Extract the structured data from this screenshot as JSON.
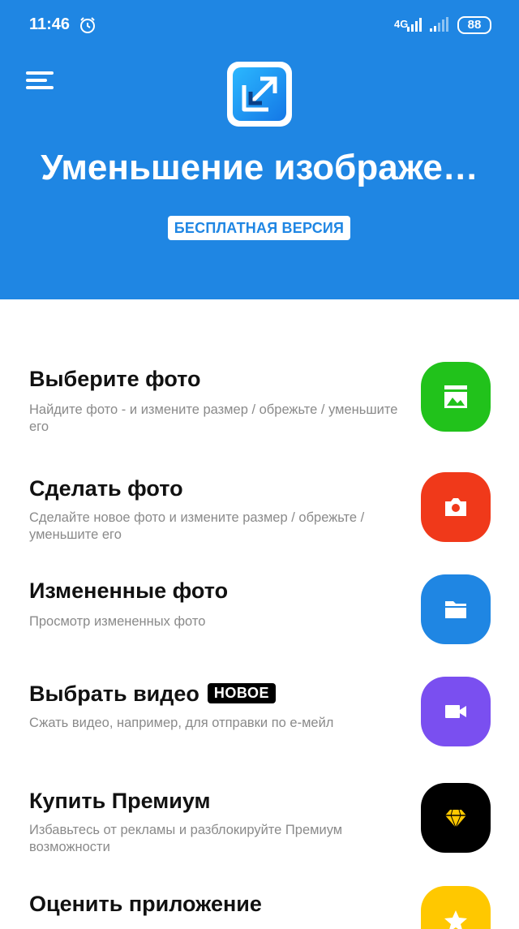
{
  "status_bar": {
    "time": "11:46",
    "network": "4G",
    "battery": "88"
  },
  "header": {
    "title": "Уменьшение изображе…",
    "version_badge": "БЕСПЛАТНАЯ ВЕРСИЯ"
  },
  "menu": [
    {
      "title": "Выберите фото",
      "description": "Найдите фото - и измените размер / обрежьте / уменьшите его",
      "icon": "gallery-icon",
      "color": "#21c21b"
    },
    {
      "title": "Сделать фото",
      "description": "Сделайте новое фото и измените размер / обрежьте / уменьшите его",
      "icon": "camera-icon",
      "color": "#f0391a"
    },
    {
      "title": "Измененные фото",
      "description": "Просмотр измененных фото",
      "icon": "folder-icon",
      "color": "#1f86e3"
    },
    {
      "title": "Выбрать видео",
      "badge": "НОВОЕ",
      "description": "Сжать видео, например, для отправки по e-мейл",
      "icon": "video-icon",
      "color": "#7a4ff0"
    },
    {
      "title": "Купить Премиум",
      "description": "Избавьтесь от рекламы и разблокируйте Премиум возможности",
      "icon": "diamond-icon",
      "color": "#000000"
    },
    {
      "title": "Оценить приложение",
      "description": "",
      "icon": "star-icon",
      "color": "#ffc800"
    }
  ]
}
